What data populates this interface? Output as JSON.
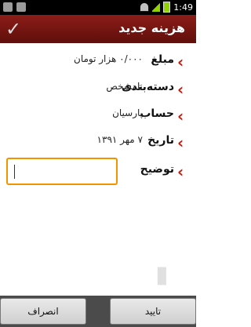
{
  "status_bar": {
    "time": "1:49"
  },
  "header": {
    "title": "هزینه جدید",
    "confirm_icon": "check-icon"
  },
  "form": {
    "amount_label": "مبلغ",
    "amount_value": "۰/۰۰۰ هزار تومان",
    "category_label": "دسته‌بندی",
    "category_value": "نامشخص",
    "account_label": "حساب",
    "account_value": "پارسیان",
    "date_label": "تاریخ",
    "date_value": "۷ مهر ۱۳۹۱",
    "description_label": "توضیح",
    "description_value": ""
  },
  "buttons": {
    "confirm_label": "تایید",
    "cancel_label": "انصراف"
  }
}
